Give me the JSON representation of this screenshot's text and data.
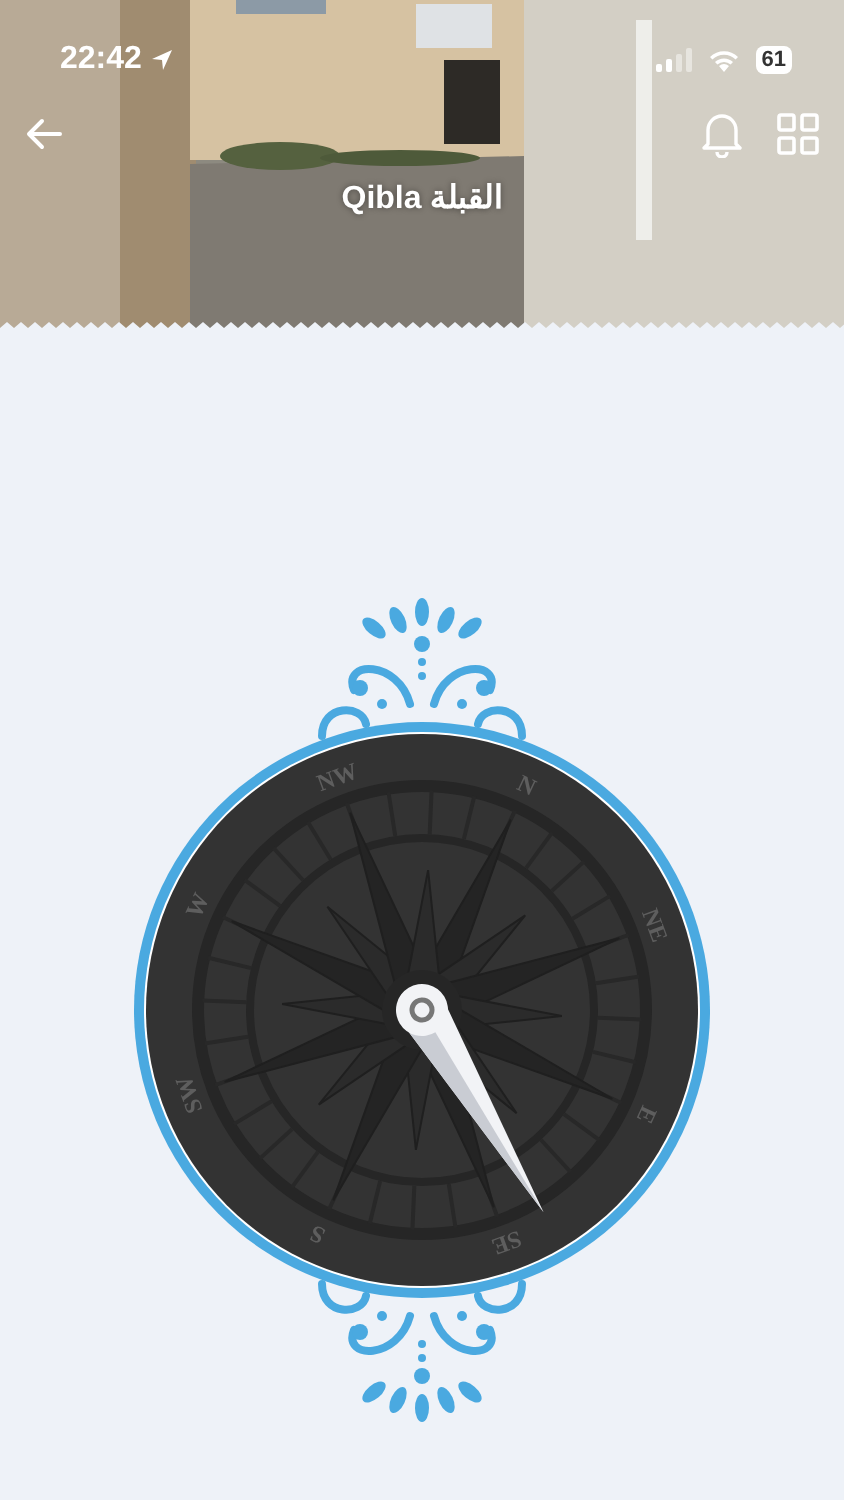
{
  "status_bar": {
    "time": "22:42",
    "battery": "61"
  },
  "header": {
    "title": "Qibla القبلة"
  },
  "compass": {
    "labels": [
      "N",
      "NE",
      "E",
      "SE",
      "S",
      "SW",
      "W",
      "NW"
    ]
  }
}
